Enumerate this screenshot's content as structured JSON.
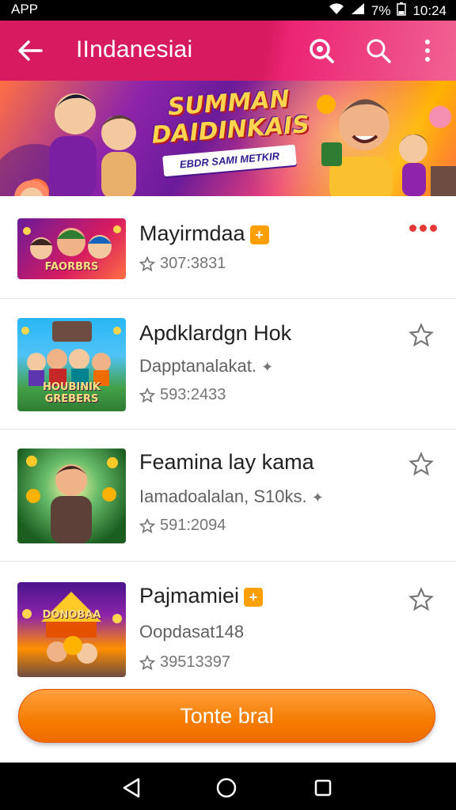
{
  "status_bar": {
    "app_label": "APP",
    "battery": "7%",
    "time": "10:24"
  },
  "app_bar": {
    "title": "IIndanesiai"
  },
  "banner": {
    "headline_line1": "SUMMAN",
    "headline_line2": "DAIDINKAIS",
    "subline": "EBDR SAMI METKIR"
  },
  "games": [
    {
      "title": "Mayirmdaa",
      "subtitle": "",
      "rating": "307:3831",
      "badge": "+",
      "thumb_label": "FAORBRS",
      "action": "more-dots"
    },
    {
      "title": "Apdklardgn Hok",
      "subtitle": "Dapptanalakat.",
      "rating": "593:2433",
      "badge": "",
      "thumb_label": "HOUBINIK GREBERS",
      "action": "star"
    },
    {
      "title": "Feamina lay kama",
      "subtitle": "Iamadoalalan, S10ks.",
      "rating": "591:2094",
      "badge": "",
      "thumb_label": "",
      "action": "star"
    },
    {
      "title": "Pajmamiei",
      "subtitle": "Oopdasat148",
      "rating": "39513397",
      "badge": "+",
      "thumb_label": "DONOBAA",
      "action": "star"
    }
  ],
  "cta": {
    "label": "Tonte bral"
  },
  "colors": {
    "app_bar": "#d81b60",
    "cta": "#f57c00",
    "badge": "#ffa000"
  }
}
